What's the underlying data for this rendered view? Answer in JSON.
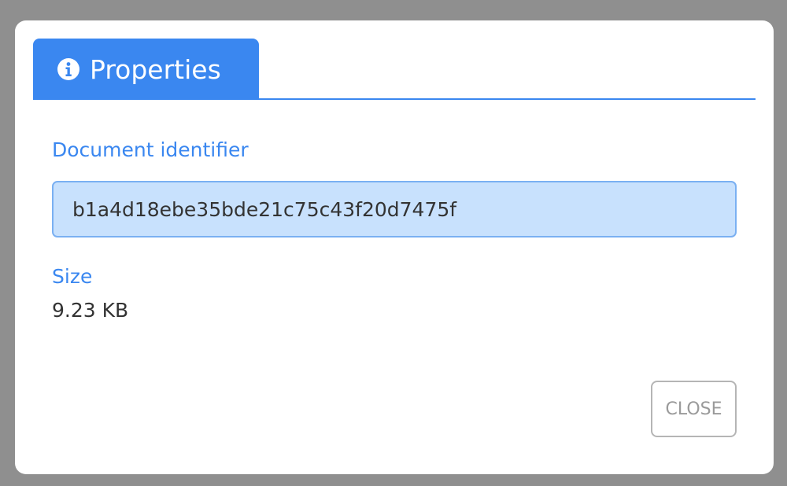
{
  "dialog": {
    "tab_label": "Properties",
    "tab_icon": "info-circle-icon",
    "accent_color": "#3a87f0",
    "fields": {
      "identifier_label": "Document identifier",
      "identifier_value": "b1a4d18ebe35bde21c75c43f20d7475f",
      "size_label": "Size",
      "size_value": "9.23 KB"
    },
    "close_label": "CLOSE"
  }
}
